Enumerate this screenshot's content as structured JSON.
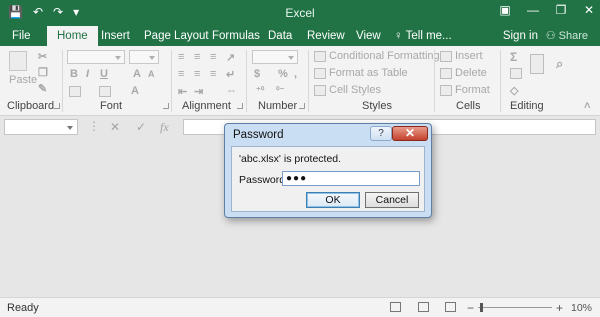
{
  "app": {
    "title": "Excel",
    "qat": {
      "save_icon": "💾",
      "undo_icon": "↶",
      "redo_icon": "↷",
      "customize_icon": "▾"
    },
    "window_icons": {
      "ribbon_display": "▣",
      "minimize": "—",
      "restore": "❐",
      "close": "✕"
    }
  },
  "tabs": {
    "file": "File",
    "home": "Home",
    "insert": "Insert",
    "page_layout": "Page Layout",
    "formulas": "Formulas",
    "data": "Data",
    "review": "Review",
    "view": "View",
    "tell_me": "Tell me...",
    "sign_in": "Sign in",
    "share": "Share"
  },
  "ribbon": {
    "clipboard": {
      "label": "Clipboard",
      "paste": "Paste"
    },
    "font": {
      "label": "Font",
      "bold": "B",
      "italic": "I",
      "underline": "U",
      "grow": "A",
      "shrink": "A"
    },
    "alignment": {
      "label": "Alignment"
    },
    "number": {
      "label": "Number",
      "currency": "$",
      "percent": "%",
      "comma": ","
    },
    "styles": {
      "label": "Styles",
      "conditional_formatting": "Conditional Formatting",
      "format_as_table": "Format as Table",
      "cell_styles": "Cell Styles"
    },
    "cells": {
      "label": "Cells",
      "insert": "Insert",
      "delete": "Delete",
      "format": "Format"
    },
    "editing": {
      "label": "Editing",
      "sum": "Σ"
    }
  },
  "formula_bar": {
    "cancel": "✕",
    "enter": "✓",
    "fx": "fx"
  },
  "status": {
    "ready": "Ready",
    "zoom": "10%",
    "zoom_minus": "−",
    "zoom_plus": "+"
  },
  "dialog": {
    "title": "Password",
    "help": "?",
    "close": "✕",
    "message": "'abc.xlsx' is protected.",
    "password_label": "Password:",
    "password_value": "●●●",
    "ok": "OK",
    "cancel": "Cancel"
  },
  "colors": {
    "brand": "#217346",
    "dialog_frame": "#c9ddf3"
  }
}
